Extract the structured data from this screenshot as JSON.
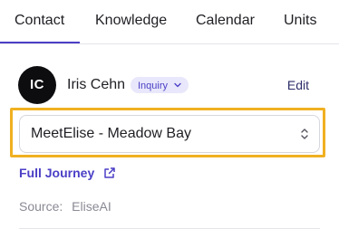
{
  "tabs": [
    {
      "label": "Contact",
      "active": true
    },
    {
      "label": "Knowledge",
      "active": false
    },
    {
      "label": "Calendar",
      "active": false
    },
    {
      "label": "Units",
      "active": false
    }
  ],
  "contact": {
    "initials": "IC",
    "name": "Iris Cehn",
    "status_badge": "Inquiry",
    "edit_label": "Edit"
  },
  "property_select": {
    "value": "MeetElise - Meadow Bay",
    "highlighted": true
  },
  "journey_link": {
    "label": "Full Journey",
    "icon": "external-link-icon"
  },
  "source": {
    "label": "Source:",
    "value": "EliseAI"
  },
  "colors": {
    "accent": "#4b3fc6",
    "highlight": "#f0b020",
    "badge_bg": "#e8e7fb",
    "avatar_bg": "#0d0d0f",
    "muted_text": "#8a8a95"
  }
}
